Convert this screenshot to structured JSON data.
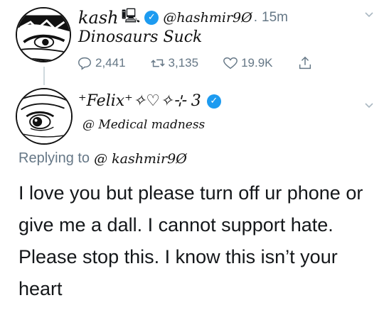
{
  "tweet": {
    "display_name": "kash",
    "name_emoji": "🖳",
    "handle": "@hashmir9Ø",
    "time_separator": ".",
    "time": "15m",
    "text": "Dinosaurs Suck",
    "actions": {
      "replies": "2,441",
      "retweets": "3,135",
      "likes": "19.9K"
    }
  },
  "reply": {
    "display_name": "⁺Felix⁺✧♡✧⊹ 3",
    "handle": "@ Medical madness",
    "replying_to_label": "Replying to",
    "replying_to_handle": "@ kashmir9Ø",
    "text": "I love you but please turn off ur phone or give me a dall.  I cannot support hate.  Please stop this. I know this isn’t your heart"
  },
  "colors": {
    "verified": "#1d9bf0",
    "secondary_text": "#657786",
    "primary_text": "#14171a"
  }
}
